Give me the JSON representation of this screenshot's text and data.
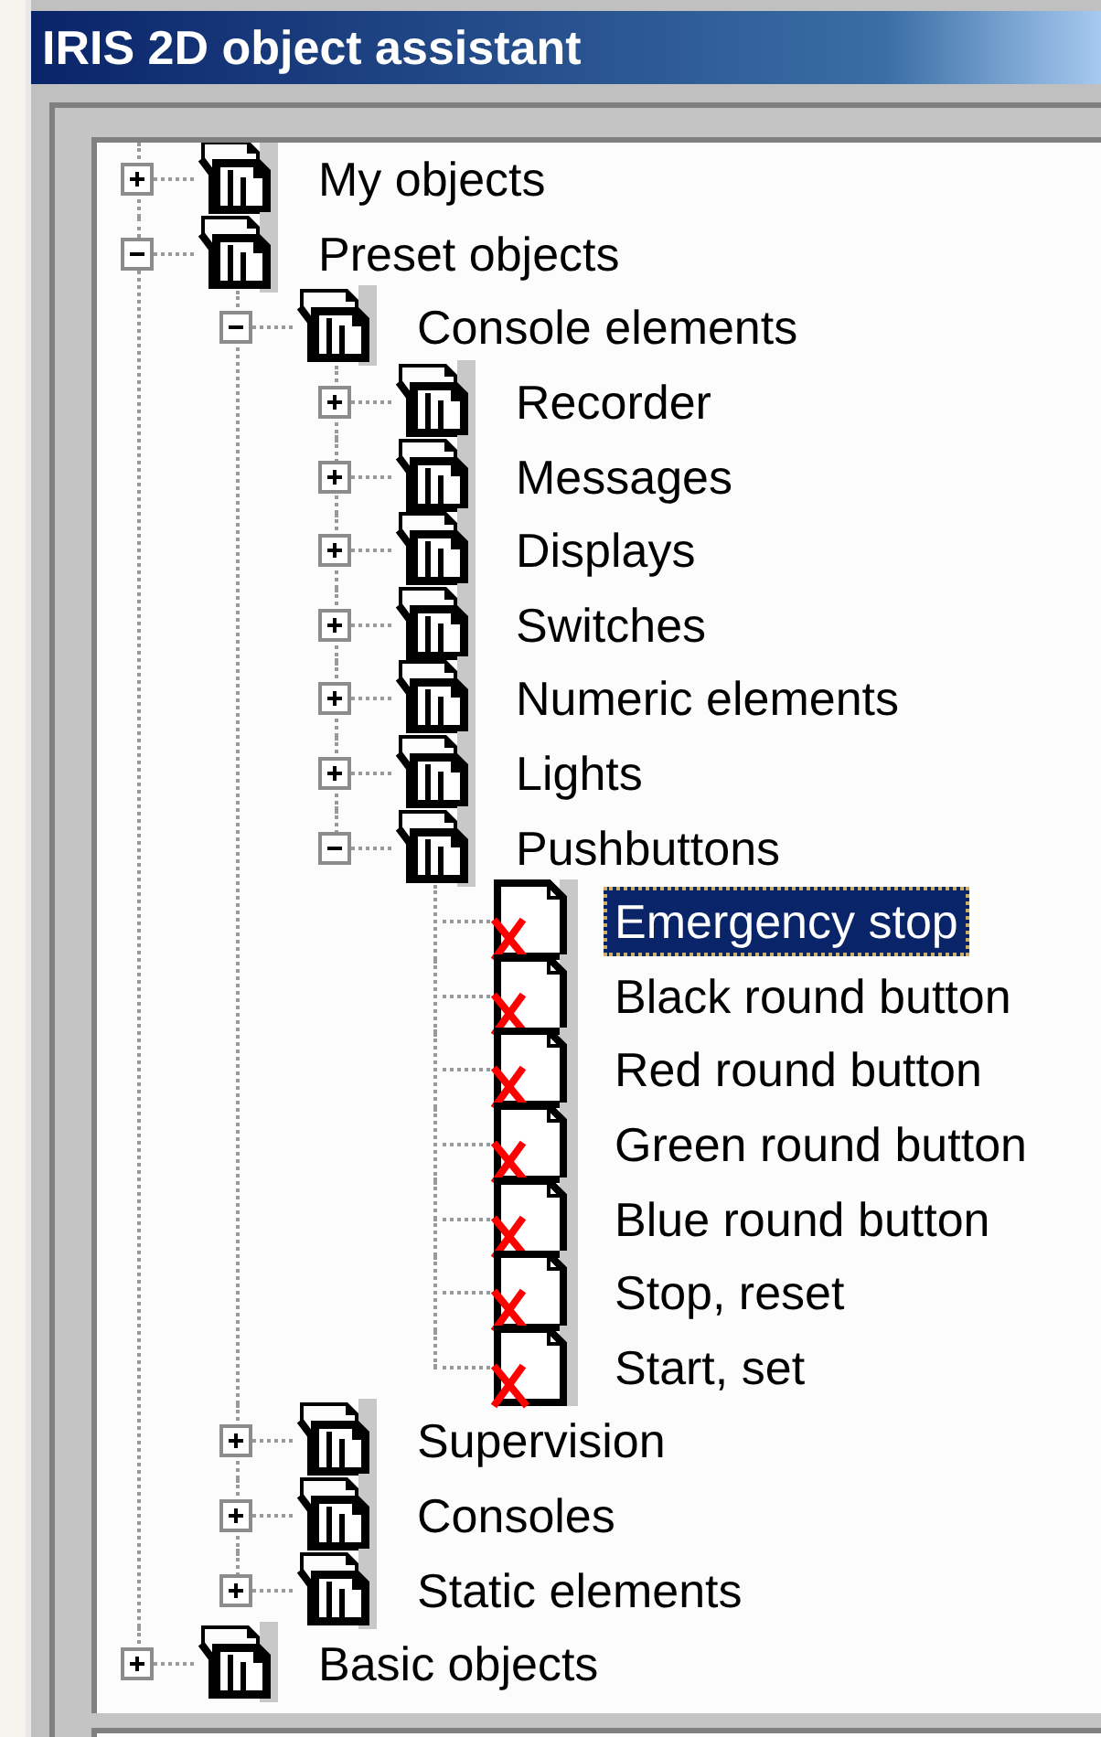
{
  "window": {
    "title": "IRIS 2D object assistant"
  },
  "tree": [
    {
      "label": "My objects",
      "kind": "group",
      "expanded": false,
      "selected": false
    },
    {
      "label": "Preset objects",
      "kind": "group",
      "expanded": true,
      "selected": false,
      "children": [
        {
          "label": "Console elements",
          "kind": "group",
          "expanded": true,
          "selected": false,
          "children": [
            {
              "label": "Recorder",
              "kind": "group",
              "expanded": false,
              "selected": false
            },
            {
              "label": "Messages",
              "kind": "group",
              "expanded": false,
              "selected": false
            },
            {
              "label": "Displays",
              "kind": "group",
              "expanded": false,
              "selected": false
            },
            {
              "label": "Switches",
              "kind": "group",
              "expanded": false,
              "selected": false
            },
            {
              "label": "Numeric elements",
              "kind": "group",
              "expanded": false,
              "selected": false
            },
            {
              "label": "Lights",
              "kind": "group",
              "expanded": false,
              "selected": false
            },
            {
              "label": "Pushbuttons",
              "kind": "group",
              "expanded": true,
              "selected": false,
              "children": [
                {
                  "label": "Emergency stop",
                  "kind": "object",
                  "selected": true
                },
                {
                  "label": "Black round button",
                  "kind": "object",
                  "selected": false
                },
                {
                  "label": "Red round button",
                  "kind": "object",
                  "selected": false
                },
                {
                  "label": "Green round button",
                  "kind": "object",
                  "selected": false
                },
                {
                  "label": "Blue round button",
                  "kind": "object",
                  "selected": false
                },
                {
                  "label": "Stop, reset",
                  "kind": "object",
                  "selected": false
                },
                {
                  "label": "Start, set",
                  "kind": "object",
                  "selected": false
                }
              ]
            }
          ]
        },
        {
          "label": "Supervision",
          "kind": "group",
          "expanded": false,
          "selected": false
        },
        {
          "label": "Consoles",
          "kind": "group",
          "expanded": false,
          "selected": false
        },
        {
          "label": "Static elements",
          "kind": "group",
          "expanded": false,
          "selected": false
        }
      ]
    },
    {
      "label": "Basic objects",
      "kind": "group",
      "expanded": false,
      "selected": false
    }
  ]
}
